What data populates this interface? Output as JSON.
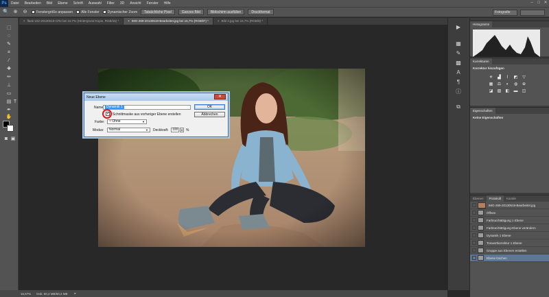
{
  "app": {
    "logo": "Ps"
  },
  "menu": [
    "Datei",
    "Bearbeiten",
    "Bild",
    "Ebene",
    "Schrift",
    "Auswahl",
    "Filter",
    "3D",
    "Ansicht",
    "Fenster",
    "Hilfe"
  ],
  "window_controls": [
    "–",
    "□",
    "✕"
  ],
  "options": {
    "fit_window": "Fenstergröße anpassen",
    "all_windows": "Alle Fenster",
    "dynamic_zoom": "Dynamischer Zoom",
    "btn_actual": "Tatsächliche Pixel",
    "btn_fit": "Ganzes Bild",
    "btn_fill": "Bildschirm ausfüllen",
    "btn_print": "Druckformat",
    "workspace": "Fotografie"
  },
  "tabs": [
    {
      "label": "flask-102-20130519-CR2 bei 16,7% (Hintergrund Kopie, RGB/16) *"
    },
    {
      "label": "IMG-269-20130519-Bearbeitet.jpg bei 16,7% (RGB/8*) *"
    },
    {
      "label": "Bild 2.jpg bei 16,7% (RGB/8) *"
    }
  ],
  "status": {
    "zoom": "16,67%",
    "doc": "Dok: 60,2 MB/60,2 MB"
  },
  "panels": {
    "histogram_tab": "Histogramm",
    "corrections_tab": "Korrekturen",
    "corrections_title": "Korrektur hinzufügen",
    "properties_tab": "Eigenschaften",
    "properties_text": "Keine Eigenschaften",
    "layers_tab": "Ebenen",
    "history_tab": "Protokoll",
    "channels_tab": "Kanäle"
  },
  "history": [
    {
      "label": "IMG-269-20130519-Bearbeitet.jpg",
      "snapshot": true
    },
    {
      "label": "Öffnen"
    },
    {
      "label": "Farbton/Sättigung 1 Ebene"
    },
    {
      "label": "Farbton/Sättigung-Ebene verändern"
    },
    {
      "label": "Dynamik 1 Ebene"
    },
    {
      "label": "Tonwertkorrektur 1 Ebene"
    },
    {
      "label": "Gruppe aus Ebenen erstellen"
    },
    {
      "label": "Ebene löschen",
      "selected": true
    }
  ],
  "dialog": {
    "title": "Neue Ebene",
    "close": "✕",
    "name_label": "Name:",
    "name_value": "Dynamik 1",
    "clip_label": "Schnittmaske aus vorheriger Ebene erstellen",
    "color_label": "Farbe:",
    "color_value": "Ohne",
    "mode_label": "Modus:",
    "mode_value": "Normal",
    "opacity_label": "Deckkraft:",
    "opacity_value": "100",
    "opacity_unit": "%",
    "ok": "OK",
    "cancel": "Abbrechen"
  },
  "colors": {
    "accent": "#3399ff",
    "highlight_ring": "#e2141c",
    "selected_row": "#5e7794"
  }
}
